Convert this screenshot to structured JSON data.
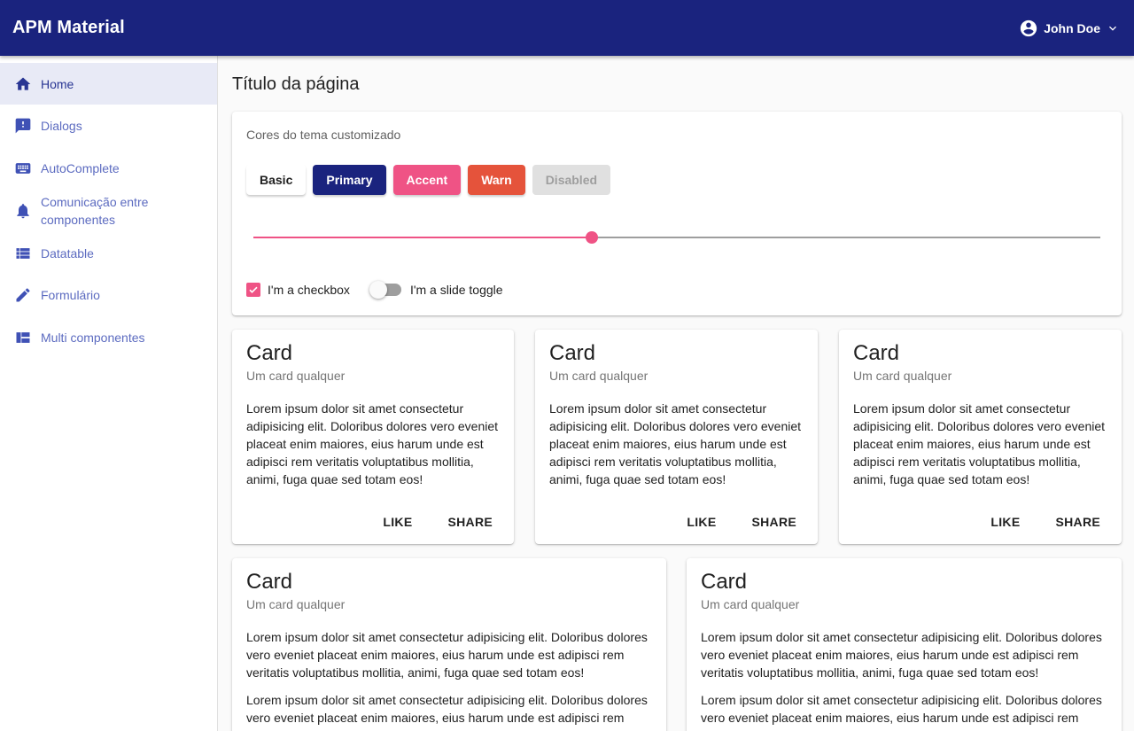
{
  "app": {
    "title": "APM Material"
  },
  "user": {
    "name": "John Doe"
  },
  "sidebar": {
    "items": [
      {
        "label": "Home",
        "icon": "home-icon",
        "active": true
      },
      {
        "label": "Dialogs",
        "icon": "feedback-icon"
      },
      {
        "label": "AutoComplete",
        "icon": "keyboard-icon"
      },
      {
        "label": "Comunicação entre componentes",
        "icon": "bell-icon"
      },
      {
        "label": "Datatable",
        "icon": "list-icon"
      },
      {
        "label": "Formulário",
        "icon": "pencil-icon"
      },
      {
        "label": "Multi componentes",
        "icon": "dashboard-icon"
      }
    ]
  },
  "page": {
    "title": "Título da página"
  },
  "theme_panel": {
    "title": "Cores do tema customizado",
    "buttons": {
      "basic": "Basic",
      "primary": "Primary",
      "accent": "Accent",
      "warn": "Warn",
      "disabled": "Disabled"
    },
    "slider_value_percent": 40,
    "checkbox": {
      "label": "I'm a checkbox",
      "checked": true
    },
    "toggle": {
      "label": "I'm a slide toggle",
      "on": false
    }
  },
  "colors": {
    "primary": "#1a237e",
    "accent": "#ef5385",
    "warn": "#e5533b",
    "nav": "#3f51b5"
  },
  "cards": [
    {
      "title": "Card",
      "subtitle": "Um card qualquer",
      "paragraphs": [
        "Lorem ipsum dolor sit amet consectetur adipisicing elit. Doloribus dolores vero eveniet placeat enim maiores, eius harum unde est adipisci rem veritatis voluptatibus mollitia, animi, fuga quae sed totam eos!"
      ],
      "actions": [
        "LIKE",
        "SHARE"
      ]
    },
    {
      "title": "Card",
      "subtitle": "Um card qualquer",
      "paragraphs": [
        "Lorem ipsum dolor sit amet consectetur adipisicing elit. Doloribus dolores vero eveniet placeat enim maiores, eius harum unde est adipisci rem veritatis voluptatibus mollitia, animi, fuga quae sed totam eos!"
      ],
      "actions": [
        "LIKE",
        "SHARE"
      ]
    },
    {
      "title": "Card",
      "subtitle": "Um card qualquer",
      "paragraphs": [
        "Lorem ipsum dolor sit amet consectetur adipisicing elit. Doloribus dolores vero eveniet placeat enim maiores, eius harum unde est adipisci rem veritatis voluptatibus mollitia, animi, fuga quae sed totam eos!"
      ],
      "actions": [
        "LIKE",
        "SHARE"
      ]
    },
    {
      "title": "Card",
      "subtitle": "Um card qualquer",
      "paragraphs": [
        "Lorem ipsum dolor sit amet consectetur adipisicing elit. Doloribus dolores vero eveniet placeat enim maiores, eius harum unde est adipisci rem veritatis voluptatibus mollitia, animi, fuga quae sed totam eos!",
        "Lorem ipsum dolor sit amet consectetur adipisicing elit. Doloribus dolores vero eveniet placeat enim maiores, eius harum unde est adipisci rem veritatis voluptatibus mollitia, animi, fuga quae sed totam eos!"
      ]
    },
    {
      "title": "Card",
      "subtitle": "Um card qualquer",
      "paragraphs": [
        "Lorem ipsum dolor sit amet consectetur adipisicing elit. Doloribus dolores vero eveniet placeat enim maiores, eius harum unde est adipisci rem veritatis voluptatibus mollitia, animi, fuga quae sed totam eos!",
        "Lorem ipsum dolor sit amet consectetur adipisicing elit. Doloribus dolores vero eveniet placeat enim maiores, eius harum unde est adipisci rem veritatis voluptatibus mollitia, animi, fuga quae sed totam eos!"
      ]
    }
  ]
}
